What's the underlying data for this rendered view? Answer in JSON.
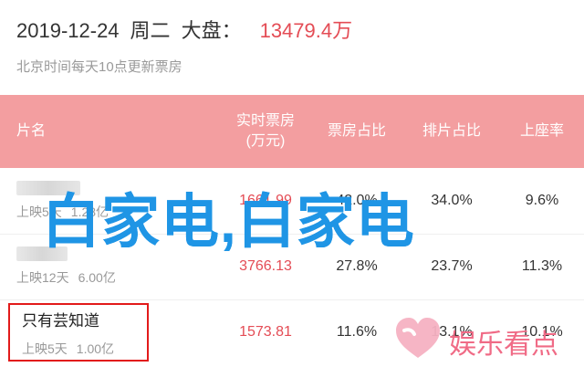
{
  "header": {
    "date": "2019-12-24",
    "weekday": "周二",
    "market_label": "大盘：",
    "market_value": "13479.4万",
    "subtitle": "北京时间每天10点更新票房"
  },
  "table": {
    "headers": {
      "name": "片名",
      "realtime_box_office_line1": "实时票房",
      "realtime_box_office_line2": "(万元)",
      "box_office_share": "票房占比",
      "screening_share": "排片占比",
      "seat_rate": "上座率"
    },
    "rows": [
      {
        "release": "上映5天",
        "total": "1.28亿",
        "realtime": "1661.99",
        "share": "42.0%",
        "screening": "34.0%",
        "seat": "9.6%"
      },
      {
        "release": "上映12天",
        "total": "6.00亿",
        "realtime": "3766.13",
        "share": "27.8%",
        "screening": "23.7%",
        "seat": "11.3%"
      },
      {
        "title": "只有芸知道",
        "release": "上映5天",
        "total": "1.00亿",
        "realtime": "1573.81",
        "share": "11.6%",
        "screening": "13.1%",
        "seat": "10.1%"
      }
    ]
  },
  "overlay": {
    "text": "白家电,白家电"
  },
  "watermark": {
    "text": "娱乐看点"
  },
  "colors": {
    "header_bg": "#f39ea0",
    "accent_red": "#e44c55",
    "overlay_blue": "#1f95e5",
    "watermark_pink": "#f06b86",
    "selection_red": "#e21a1a"
  }
}
